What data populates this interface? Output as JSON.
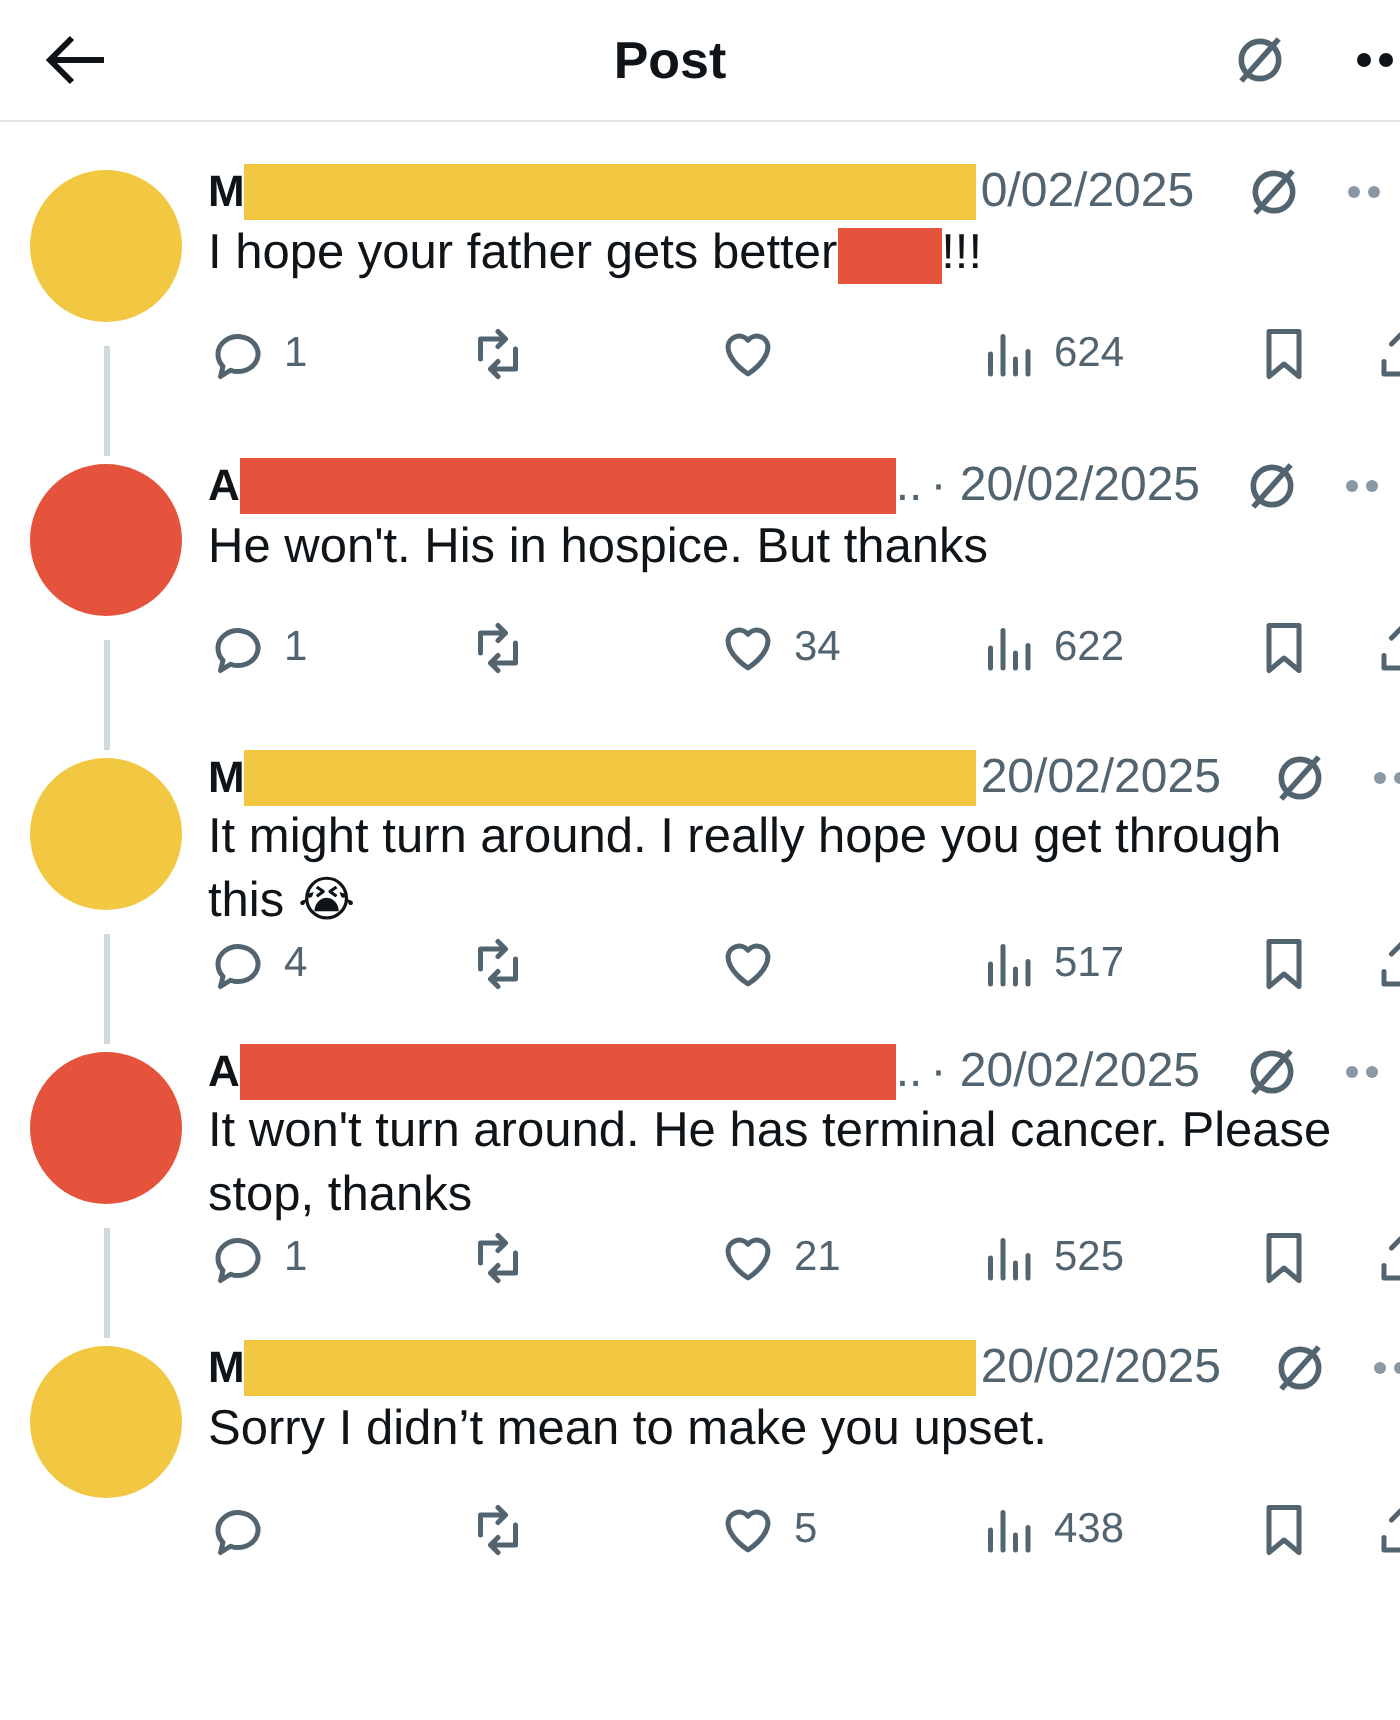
{
  "header": {
    "title": "Post"
  },
  "replies": [
    {
      "color": "#f2c843",
      "initial": "M",
      "date": "0/02/2025",
      "segments": [
        {
          "kind": "text",
          "text": "I hope your father gets better"
        },
        {
          "kind": "redaction"
        },
        {
          "kind": "text",
          "text": "!!!"
        }
      ],
      "replies": "1",
      "views": "624"
    },
    {
      "color": "#e5533d",
      "initial": "A",
      "ellipsis": "..",
      "date": "· 20/02/2025",
      "segments": [
        {
          "kind": "text",
          "text": "He won't. His in hospice. But thanks"
        }
      ],
      "replies": "1",
      "likes": "34",
      "views": "622"
    },
    {
      "color": "#f2c843",
      "initial": "M",
      "date": "20/02/2025",
      "segments": [
        {
          "kind": "text",
          "text": "It might turn around. I really hope you get through this"
        }
      ],
      "emoji": "😭",
      "replies": "4",
      "views": "517"
    },
    {
      "color": "#e5533d",
      "initial": "A",
      "ellipsis": "..",
      "date": "· 20/02/2025",
      "segments": [
        {
          "kind": "text",
          "text": "It won't turn around. He has terminal cancer. Please stop, thanks"
        }
      ],
      "replies": "1",
      "likes": "21",
      "views": "525"
    },
    {
      "color": "#f2c843",
      "initial": "M",
      "date": "20/02/2025",
      "segments": [
        {
          "kind": "text",
          "text": "Sorry I didn’t mean to make you upset."
        }
      ],
      "likes": "5",
      "views": "438"
    }
  ]
}
